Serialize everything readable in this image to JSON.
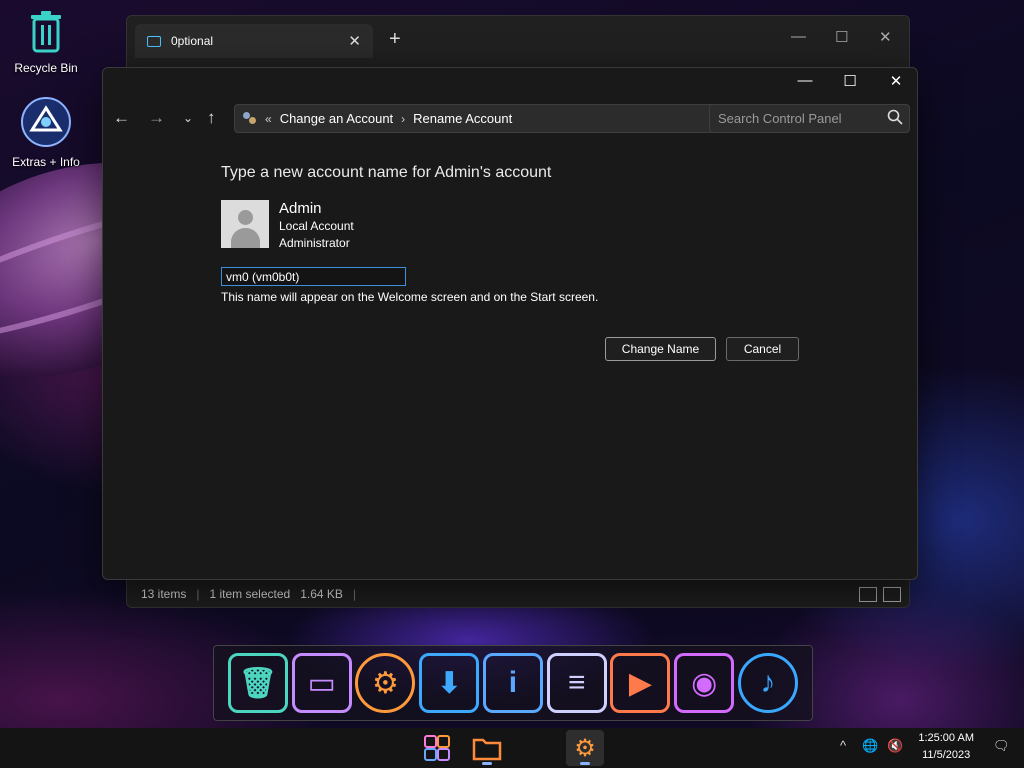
{
  "desktop": {
    "icons": [
      {
        "label": "Recycle Bin"
      },
      {
        "label": "Extras + Info"
      }
    ]
  },
  "explorer": {
    "tab_title": "0ptional",
    "status": {
      "items": "13 items",
      "selected": "1 item selected",
      "size": "1.64 KB"
    }
  },
  "control_panel": {
    "breadcrumb": [
      "Change an Account",
      "Rename Account"
    ],
    "search_placeholder": "Search Control Panel",
    "heading": "Type a new account name for Admin's account",
    "account": {
      "name": "Admin",
      "type": "Local Account",
      "role": "Administrator"
    },
    "new_name_value": "vm0 (vm0b0t)",
    "hint": "This name will appear on the Welcome screen and on the Start screen.",
    "buttons": {
      "change_name": "Change Name",
      "cancel": "Cancel"
    }
  },
  "dock": {
    "icons": [
      "trash-icon",
      "monitor-icon",
      "settings-icon",
      "download-icon",
      "info-icon",
      "notes-icon",
      "video-icon",
      "camera-icon",
      "music-icon"
    ],
    "colors": [
      "#4cd6c0",
      "#c58cff",
      "#ff9a3c",
      "#3ca9ff",
      "#5aa8ff",
      "#d0d0ff",
      "#ff7a4a",
      "#d36bff",
      "#39a8ff"
    ]
  },
  "taskbar": {
    "time": "1:25:00 AM",
    "date": "11/5/2023"
  }
}
